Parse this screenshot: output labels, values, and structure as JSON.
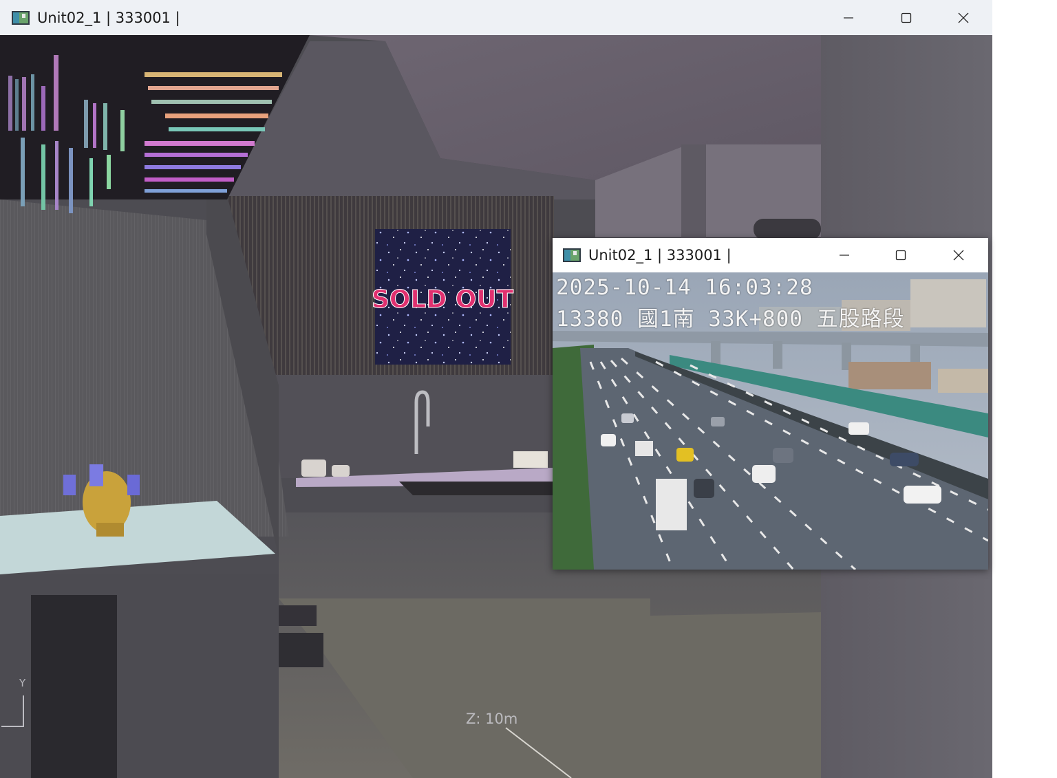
{
  "main_window": {
    "title": "Unit02_1 | 333001 |",
    "controls": {
      "minimize": "minimize-icon",
      "maximize": "maximize-icon",
      "close": "close-icon"
    }
  },
  "scene": {
    "poster_text": "SOLD OUT",
    "axis_label_y": "Y",
    "zoom_readout": "Z: 10m"
  },
  "camera_window": {
    "title": "Unit02_1 | 333001 |",
    "controls": {
      "minimize": "minimize-icon",
      "maximize": "maximize-icon",
      "close": "close-icon"
    },
    "osd_datetime": "2025-10-14 16:03:28",
    "osd_location": "13380 國1南 33K+800 五股路段"
  },
  "colors": {
    "titlebar_main": "#eef1f5",
    "titlebar_popup": "#ffffff",
    "poster_text": "#e0306f",
    "close_hover": "#c42b1c"
  }
}
